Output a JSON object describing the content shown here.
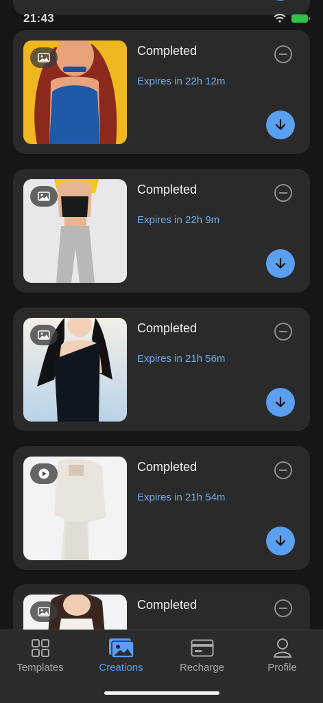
{
  "status_bar": {
    "time": "21:43"
  },
  "cards": [
    {
      "status": "Completed",
      "expiry": "Expires in 22h 12m",
      "media": "image-icon"
    },
    {
      "status": "Completed",
      "expiry": "Expires in 22h 9m",
      "media": "image-icon"
    },
    {
      "status": "Completed",
      "expiry": "Expires in 21h 56m",
      "media": "image-icon"
    },
    {
      "status": "Completed",
      "expiry": "Expires in 21h 54m",
      "media": "play-icon"
    },
    {
      "status": "Completed",
      "expiry": "",
      "media": "image-icon"
    }
  ],
  "tabs": [
    {
      "label": "Templates",
      "icon": "grid-icon",
      "active": false
    },
    {
      "label": "Creations",
      "icon": "gallery-icon",
      "active": true
    },
    {
      "label": "Recharge",
      "icon": "card-icon",
      "active": false
    },
    {
      "label": "Profile",
      "icon": "person-icon",
      "active": false
    }
  ],
  "colors": {
    "accent": "#5a9ff0",
    "expiry": "#6fb0f2",
    "card": "#2a2a2a",
    "background": "#161616"
  }
}
